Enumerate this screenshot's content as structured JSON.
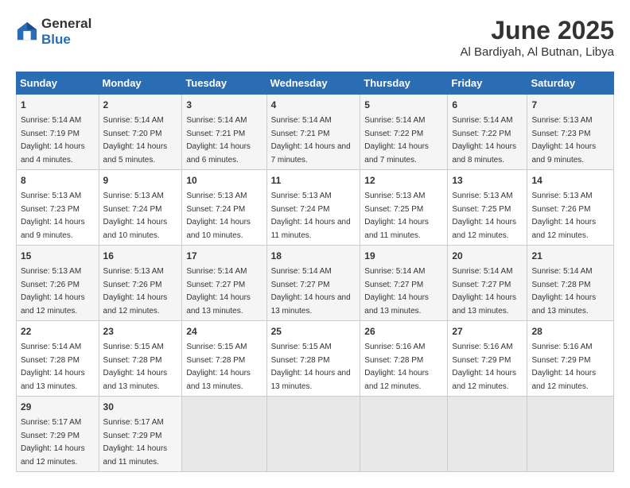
{
  "logo": {
    "general": "General",
    "blue": "Blue"
  },
  "title": "June 2025",
  "subtitle": "Al Bardiyah, Al Butnan, Libya",
  "days_header": [
    "Sunday",
    "Monday",
    "Tuesday",
    "Wednesday",
    "Thursday",
    "Friday",
    "Saturday"
  ],
  "weeks": [
    [
      {
        "day": "1",
        "sunrise": "5:14 AM",
        "sunset": "7:19 PM",
        "daylight": "14 hours and 4 minutes."
      },
      {
        "day": "2",
        "sunrise": "5:14 AM",
        "sunset": "7:20 PM",
        "daylight": "14 hours and 5 minutes."
      },
      {
        "day": "3",
        "sunrise": "5:14 AM",
        "sunset": "7:21 PM",
        "daylight": "14 hours and 6 minutes."
      },
      {
        "day": "4",
        "sunrise": "5:14 AM",
        "sunset": "7:21 PM",
        "daylight": "14 hours and 7 minutes."
      },
      {
        "day": "5",
        "sunrise": "5:14 AM",
        "sunset": "7:22 PM",
        "daylight": "14 hours and 7 minutes."
      },
      {
        "day": "6",
        "sunrise": "5:14 AM",
        "sunset": "7:22 PM",
        "daylight": "14 hours and 8 minutes."
      },
      {
        "day": "7",
        "sunrise": "5:13 AM",
        "sunset": "7:23 PM",
        "daylight": "14 hours and 9 minutes."
      }
    ],
    [
      {
        "day": "8",
        "sunrise": "5:13 AM",
        "sunset": "7:23 PM",
        "daylight": "14 hours and 9 minutes."
      },
      {
        "day": "9",
        "sunrise": "5:13 AM",
        "sunset": "7:24 PM",
        "daylight": "14 hours and 10 minutes."
      },
      {
        "day": "10",
        "sunrise": "5:13 AM",
        "sunset": "7:24 PM",
        "daylight": "14 hours and 10 minutes."
      },
      {
        "day": "11",
        "sunrise": "5:13 AM",
        "sunset": "7:24 PM",
        "daylight": "14 hours and 11 minutes."
      },
      {
        "day": "12",
        "sunrise": "5:13 AM",
        "sunset": "7:25 PM",
        "daylight": "14 hours and 11 minutes."
      },
      {
        "day": "13",
        "sunrise": "5:13 AM",
        "sunset": "7:25 PM",
        "daylight": "14 hours and 12 minutes."
      },
      {
        "day": "14",
        "sunrise": "5:13 AM",
        "sunset": "7:26 PM",
        "daylight": "14 hours and 12 minutes."
      }
    ],
    [
      {
        "day": "15",
        "sunrise": "5:13 AM",
        "sunset": "7:26 PM",
        "daylight": "14 hours and 12 minutes."
      },
      {
        "day": "16",
        "sunrise": "5:13 AM",
        "sunset": "7:26 PM",
        "daylight": "14 hours and 12 minutes."
      },
      {
        "day": "17",
        "sunrise": "5:14 AM",
        "sunset": "7:27 PM",
        "daylight": "14 hours and 13 minutes."
      },
      {
        "day": "18",
        "sunrise": "5:14 AM",
        "sunset": "7:27 PM",
        "daylight": "14 hours and 13 minutes."
      },
      {
        "day": "19",
        "sunrise": "5:14 AM",
        "sunset": "7:27 PM",
        "daylight": "14 hours and 13 minutes."
      },
      {
        "day": "20",
        "sunrise": "5:14 AM",
        "sunset": "7:27 PM",
        "daylight": "14 hours and 13 minutes."
      },
      {
        "day": "21",
        "sunrise": "5:14 AM",
        "sunset": "7:28 PM",
        "daylight": "14 hours and 13 minutes."
      }
    ],
    [
      {
        "day": "22",
        "sunrise": "5:14 AM",
        "sunset": "7:28 PM",
        "daylight": "14 hours and 13 minutes."
      },
      {
        "day": "23",
        "sunrise": "5:15 AM",
        "sunset": "7:28 PM",
        "daylight": "14 hours and 13 minutes."
      },
      {
        "day": "24",
        "sunrise": "5:15 AM",
        "sunset": "7:28 PM",
        "daylight": "14 hours and 13 minutes."
      },
      {
        "day": "25",
        "sunrise": "5:15 AM",
        "sunset": "7:28 PM",
        "daylight": "14 hours and 13 minutes."
      },
      {
        "day": "26",
        "sunrise": "5:16 AM",
        "sunset": "7:28 PM",
        "daylight": "14 hours and 12 minutes."
      },
      {
        "day": "27",
        "sunrise": "5:16 AM",
        "sunset": "7:29 PM",
        "daylight": "14 hours and 12 minutes."
      },
      {
        "day": "28",
        "sunrise": "5:16 AM",
        "sunset": "7:29 PM",
        "daylight": "14 hours and 12 minutes."
      }
    ],
    [
      {
        "day": "29",
        "sunrise": "5:17 AM",
        "sunset": "7:29 PM",
        "daylight": "14 hours and 12 minutes."
      },
      {
        "day": "30",
        "sunrise": "5:17 AM",
        "sunset": "7:29 PM",
        "daylight": "14 hours and 11 minutes."
      },
      null,
      null,
      null,
      null,
      null
    ]
  ],
  "labels": {
    "sunrise": "Sunrise:",
    "sunset": "Sunset:",
    "daylight": "Daylight: "
  }
}
